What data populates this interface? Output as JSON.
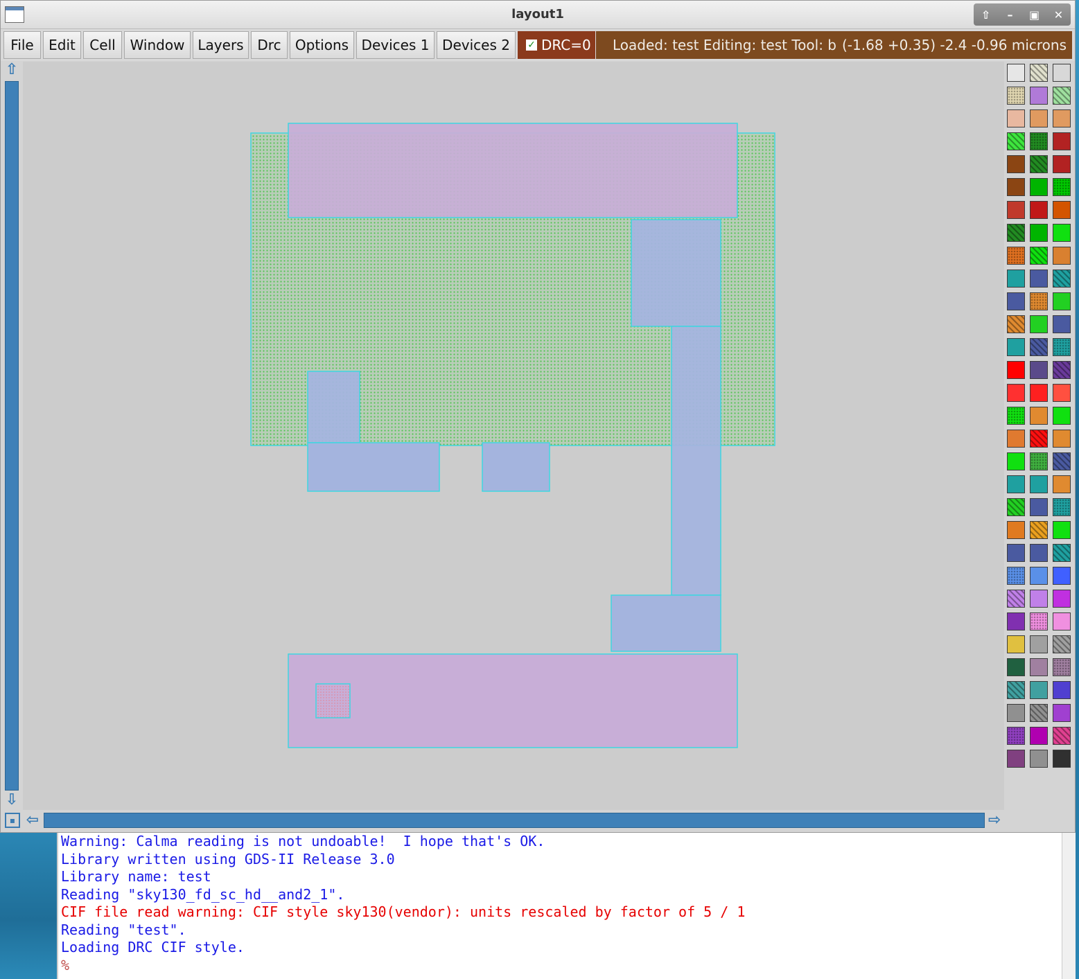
{
  "window": {
    "title": "layout1",
    "controls": [
      "up-icon",
      "minimize-icon",
      "maximize-icon",
      "close-icon"
    ]
  },
  "menubar": {
    "items": [
      "File",
      "Edit",
      "Cell",
      "Window",
      "Layers",
      "Drc",
      "Options",
      "Devices 1",
      "Devices 2"
    ],
    "drc_label": "DRC=0",
    "drc_checked": true,
    "status_left": "Loaded: test Editing: test Tool: b",
    "status_right": "(-1.68 +0.35) -2.4 -0.96 microns",
    "drc_color": "#8b3a1c",
    "status_color": "#7d4a1f"
  },
  "layout": {
    "background_color": "#cccccc",
    "layers": {
      "nwell": "#8cd28c",
      "poly": "#c8aed7",
      "metal": "#a4b4de",
      "outline": "#3fd6e0"
    }
  },
  "palette": {
    "columns": 3,
    "swatches": [
      "#e6e6e6",
      "#e0e0cc",
      "#d8d8d8",
      "#e0d6b0",
      "#b07ad8",
      "#9fe09f",
      "#e8b8a0",
      "#e09a60",
      "#e09a60",
      "#3ee63e",
      "#228b22",
      "#b22222",
      "#8b4513",
      "#228b22",
      "#b22222",
      "#8b4513",
      "#00b400",
      "#00c800",
      "#c0392b",
      "#c01818",
      "#d35400",
      "#228b22",
      "#00b400",
      "#10e010",
      "#e07020",
      "#10e010",
      "#d98030",
      "#1fa0a0",
      "#4a5aa0",
      "#1fa0a0",
      "#4a5aa0",
      "#e08a30",
      "#22d022",
      "#e08a30",
      "#22d022",
      "#4a5aa0",
      "#1fa0a0",
      "#4a5aa0",
      "#1fa0a0",
      "#ff0000",
      "#5a4a8a",
      "#6a3a9a",
      "#ff3030",
      "#ff2020",
      "#ff5040",
      "#10e010",
      "#e08a30",
      "#10e010",
      "#e07a30",
      "#ff1010",
      "#e08a30",
      "#10e010",
      "#40b040",
      "#4a5aa0",
      "#1fa0a0",
      "#1fa0a0",
      "#e08a30",
      "#22d022",
      "#4a5aa0",
      "#1fa0a0",
      "#e07a20",
      "#eaa020",
      "#10e010",
      "#4a5aa0",
      "#4a5aa0",
      "#1fa0a0",
      "#5a90e8",
      "#5a90e8",
      "#4060ff",
      "#c080e8",
      "#c080e8",
      "#c030e0",
      "#8030b0",
      "#f090e0",
      "#f090e0",
      "#e0c040",
      "#a0a0a0",
      "#a0a0a0",
      "#206040",
      "#a080a0",
      "#a080a0",
      "#40a0a0",
      "#40a0a0",
      "#5040d0",
      "#909090",
      "#909090",
      "#a040d0",
      "#9040c0",
      "#b000b0",
      "#e04090",
      "#804080",
      "#909090",
      "#303030"
    ]
  },
  "console": {
    "lines": [
      {
        "text": "Warning: Calma reading is not undoable!  I hope that's OK.",
        "color": "#1a1ae6"
      },
      {
        "text": "Library written using GDS-II Release 3.0",
        "color": "#1a1ae6"
      },
      {
        "text": "Library name: test",
        "color": "#1a1ae6"
      },
      {
        "text": "Reading \"sky130_fd_sc_hd__and2_1\".",
        "color": "#1a1ae6"
      },
      {
        "text": "CIF file read warning: CIF style sky130(vendor): units rescaled by factor of 5 / 1",
        "color": "#e60000"
      },
      {
        "text": "Reading \"test\".",
        "color": "#1a1ae6"
      },
      {
        "text": "Loading DRC CIF style.",
        "color": "#1a1ae6"
      },
      {
        "text": "%",
        "color": "#c0504d"
      }
    ]
  }
}
